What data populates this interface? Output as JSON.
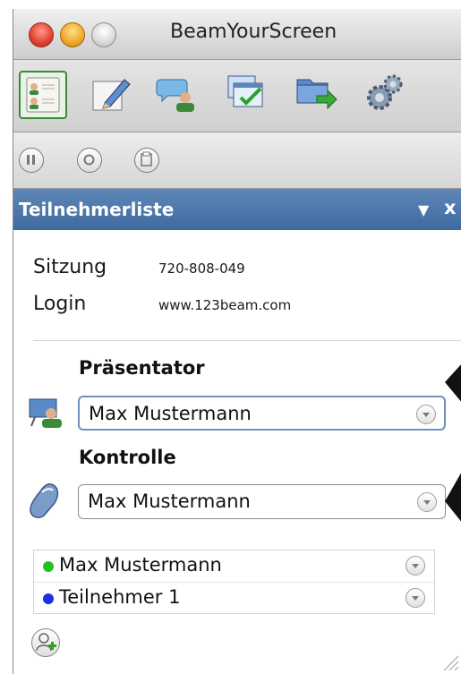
{
  "window": {
    "title": "BeamYourScreen"
  },
  "toolbar": {
    "tools": [
      {
        "icon": "participant-list-icon",
        "selected": true
      },
      {
        "icon": "pencil-annotation-icon",
        "selected": false
      },
      {
        "icon": "chat-user-icon",
        "selected": false
      },
      {
        "icon": "window-select-icon",
        "selected": false
      },
      {
        "icon": "file-transfer-icon",
        "selected": false
      },
      {
        "icon": "settings-gears-icon",
        "selected": false
      }
    ]
  },
  "controls": {
    "buttons": [
      {
        "icon": "pause-icon"
      },
      {
        "icon": "record-icon"
      },
      {
        "icon": "clipboard-icon"
      }
    ]
  },
  "panel": {
    "title": "Teilnehmerliste",
    "collapse_glyph": "▼",
    "close_glyph": "x"
  },
  "session": {
    "session_label": "Sitzung",
    "session_value": "720-808-049",
    "login_label": "Login",
    "login_value": "www.123beam.com"
  },
  "presenter": {
    "label": "Präsentator",
    "selected": "Max Mustermann"
  },
  "control": {
    "label": "Kontrolle",
    "selected": "Max Mustermann"
  },
  "participants": [
    {
      "name": "Max Mustermann",
      "status_color": "#1ec41e"
    },
    {
      "name": "Teilnehmer 1",
      "status_color": "#1a2fe6"
    }
  ],
  "colors": {
    "panel_header": "#4a73a8",
    "selected_tool_border": "#3a8a3a"
  }
}
